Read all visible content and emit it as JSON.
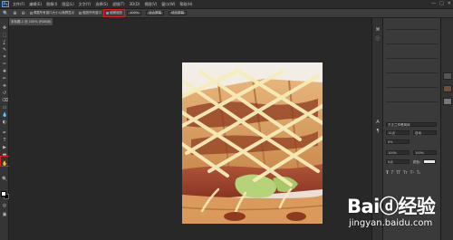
{
  "app": {
    "logo_text": "Ps",
    "menu": [
      "文件(F)",
      "编辑(E)",
      "图像(I)",
      "图层(L)",
      "文字(Y)",
      "选择(S)",
      "滤镜(T)",
      "3D(D)",
      "视图(V)",
      "窗口(W)",
      "帮助(H)"
    ],
    "window_controls": [
      "—",
      "□",
      "✕"
    ]
  },
  "options_bar": {
    "items": [
      {
        "label": "调整所有窗口大小以满屏显示",
        "type": "checkbox"
      },
      {
        "label": "缩放所有窗口",
        "type": "checkbox"
      },
      {
        "label": "细微缩放",
        "type": "checkbox",
        "highlighted": true
      },
      {
        "label": "100%",
        "type": "button"
      },
      {
        "label": "适合屏幕",
        "type": "button"
      },
      {
        "label": "填充屏幕",
        "type": "button"
      }
    ]
  },
  "document_tab": {
    "label": "未标题-1 @ 100% (RGB/8)"
  },
  "tools": {
    "icons": [
      "move-icon",
      "marquee-icon",
      "lasso-icon",
      "quick-select-icon",
      "crop-icon",
      "eyedropper-icon",
      "healing-icon",
      "brush-icon",
      "clone-stamp-icon",
      "history-brush-icon",
      "eraser-icon",
      "gradient-icon",
      "blur-icon",
      "dodge-icon",
      "pen-icon",
      "type-icon",
      "path-select-icon",
      "shape-icon",
      "hand-icon",
      "zoom-icon"
    ],
    "glyphs": [
      "✥",
      "⬚",
      "ʆ",
      "✎",
      "⌗",
      "✑",
      "✚",
      "✏",
      "⎈",
      "↺",
      "⌫",
      "▭",
      "💧",
      "◐",
      "✒",
      "T",
      "▶",
      "▬",
      "✋",
      "🔍"
    ]
  },
  "swatches": {
    "foreground": "#ffffff",
    "background": "#000000"
  },
  "panels": {
    "character": {
      "labels": [
        "方正兰亭黑简体",
        "12点",
        "自动",
        "0%",
        "100%",
        "100%",
        "0点",
        "颜色:"
      ]
    }
  },
  "watermark": {
    "brand": "Baiⓓ经验",
    "url": "jingyan.baidu.com"
  },
  "colors": {
    "highlight": "#e02020",
    "accent": "#4da3ff"
  }
}
